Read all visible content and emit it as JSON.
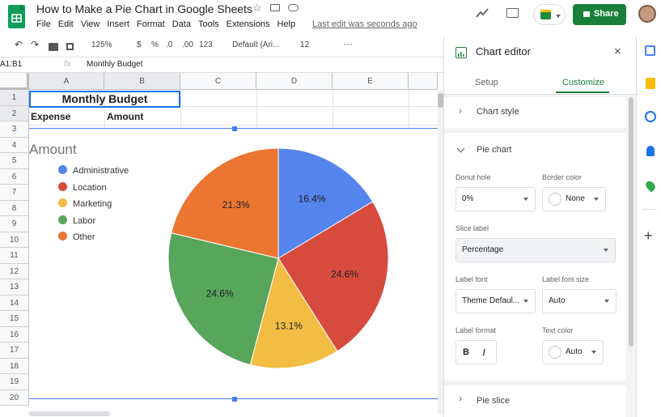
{
  "app": {
    "title": "How to Make a Pie Chart in Google Sheets",
    "last_edit": "Last edit was seconds ago",
    "share_label": "Share"
  },
  "menu": [
    "File",
    "Edit",
    "View",
    "Insert",
    "Format",
    "Data",
    "Tools",
    "Extensions",
    "Help"
  ],
  "toolbar": {
    "zoom": "125%",
    "currency": "$",
    "percent": "%",
    "dec_less": ".0",
    "dec_more": ".00",
    "num_format": "123",
    "font": "Default (Ari...",
    "font_size": "12"
  },
  "formula_bar": {
    "cell_ref": "A1:B1",
    "fx": "fx",
    "value": "Monthly Budget"
  },
  "grid": {
    "columns": [
      "A",
      "B",
      "C",
      "D",
      "E"
    ],
    "rows": [
      "1",
      "2",
      "3",
      "4",
      "5",
      "6",
      "7",
      "8",
      "9",
      "10",
      "11",
      "12",
      "13",
      "14",
      "15",
      "16",
      "17",
      "18",
      "19",
      "20"
    ],
    "cells": {
      "title": "Monthly Budget",
      "a2": "Expense",
      "b2": "Amount"
    }
  },
  "chart_data": {
    "type": "pie",
    "title": "Amount",
    "slices": [
      {
        "name": "Administrative",
        "value": 16.4,
        "label": "16.4%",
        "color": "#5484ec"
      },
      {
        "name": "Location",
        "value": 24.6,
        "label": "24.6%",
        "color": "#d74b3e"
      },
      {
        "name": "Marketing",
        "value": 13.1,
        "label": "13.1%",
        "color": "#f2bd42"
      },
      {
        "name": "Labor",
        "value": 24.6,
        "label": "24.6%",
        "color": "#58a55c"
      },
      {
        "name": "Other",
        "value": 21.3,
        "label": "21.3%",
        "color": "#ec7631"
      }
    ],
    "legend": "left"
  },
  "editor": {
    "title": "Chart editor",
    "tabs": [
      "Setup",
      "Customize"
    ],
    "sections": {
      "chart_style": "Chart style",
      "pie_chart": "Pie chart",
      "pie_slice": "Pie slice"
    },
    "donut_hole": {
      "label": "Donut hole",
      "value": "0%"
    },
    "border_color": {
      "label": "Border color",
      "value": "None"
    },
    "slice_label": {
      "label": "Slice label",
      "value": "Percentage"
    },
    "label_font": {
      "label": "Label font",
      "value": "Theme Defaul..."
    },
    "label_font_size": {
      "label": "Label font size",
      "value": "Auto"
    },
    "label_format": {
      "label": "Label format",
      "bold": "B",
      "italic": "I"
    },
    "text_color": {
      "label": "Text color",
      "value": "Auto"
    }
  },
  "colors": {
    "accent": "#188038",
    "share": "#188038",
    "tab_active": "#188038"
  }
}
